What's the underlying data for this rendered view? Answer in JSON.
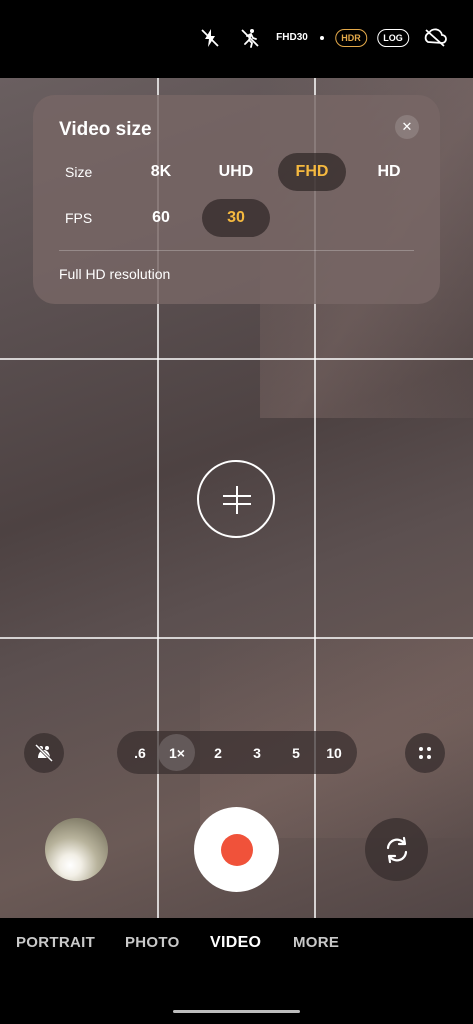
{
  "status_bar": {
    "icons": [
      "flash-off",
      "motion-photo-off",
      "resolution-fps",
      "hdr",
      "log",
      "auto-framing"
    ],
    "resolution_top": "FHD",
    "resolution_bottom": "30",
    "hdr_label": "HDR",
    "log_label": "LOG"
  },
  "video_size_panel": {
    "title": "Video size",
    "size_label": "Size",
    "fps_label": "FPS",
    "size_options": [
      "8K",
      "UHD",
      "FHD",
      "HD"
    ],
    "selected_size": "FHD",
    "fps_options": [
      "60",
      "30"
    ],
    "selected_fps": "30",
    "description": "Full HD resolution"
  },
  "zoom": {
    "options": [
      ".6",
      "1×",
      "2",
      "3",
      "5",
      "10"
    ],
    "selected": "1×"
  },
  "modes": {
    "items": [
      "PORTRAIT",
      "PHOTO",
      "VIDEO",
      "MORE"
    ],
    "active": "VIDEO"
  },
  "colors": {
    "accent": "#f5b93f",
    "hdr": "#e4a94a",
    "record": "#f0523a"
  }
}
